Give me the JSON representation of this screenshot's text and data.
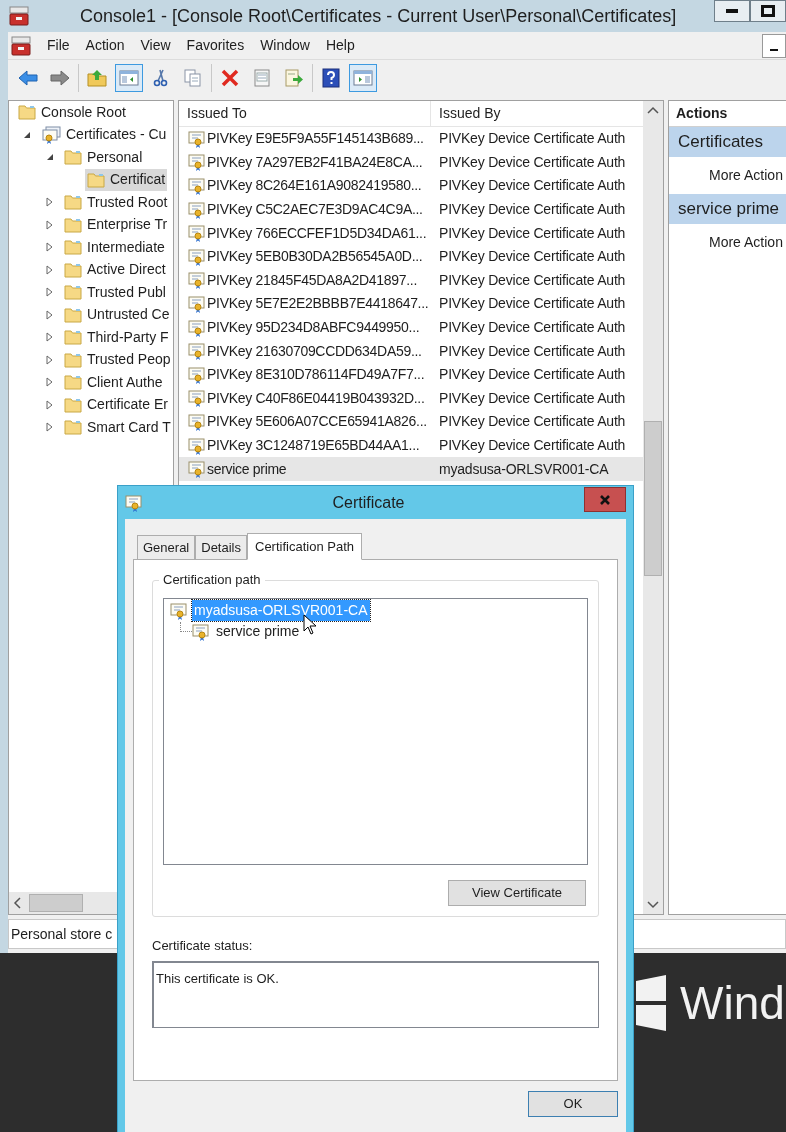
{
  "window": {
    "title": "Console1 - [Console Root\\Certificates - Current User\\Personal\\Certificates]"
  },
  "menu": [
    "File",
    "Action",
    "View",
    "Favorites",
    "Window",
    "Help"
  ],
  "toolbar_groups": [
    [
      {
        "kind": "back",
        "pressed": false
      },
      {
        "kind": "forward",
        "pressed": false
      }
    ],
    [
      {
        "kind": "up",
        "pressed": false
      },
      {
        "kind": "tree",
        "pressed": true
      },
      {
        "kind": "cut",
        "pressed": false
      },
      {
        "kind": "copy",
        "pressed": false
      }
    ],
    [
      {
        "kind": "delete",
        "pressed": false
      },
      {
        "kind": "properties",
        "pressed": false
      },
      {
        "kind": "export",
        "pressed": false
      }
    ],
    [
      {
        "kind": "help",
        "pressed": false
      },
      {
        "kind": "actionpane",
        "pressed": true
      }
    ]
  ],
  "tree": [
    {
      "label": "Console Root",
      "kind": "folder",
      "selected": false,
      "children": [
        {
          "label": "Certificates - Cu",
          "kind": "store",
          "expanded": true,
          "selected": false,
          "children": [
            {
              "label": "Personal",
              "kind": "folder",
              "expanded": true,
              "selected": false,
              "children": [
                {
                  "label": "Certificat",
                  "kind": "folder",
                  "selected": true
                }
              ]
            },
            {
              "label": "Trusted Root",
              "kind": "folder",
              "expanded": false,
              "selected": false
            },
            {
              "label": "Enterprise Tr",
              "kind": "folder",
              "expanded": false,
              "selected": false
            },
            {
              "label": "Intermediate",
              "kind": "folder",
              "expanded": false,
              "selected": false
            },
            {
              "label": "Active Direct",
              "kind": "folder",
              "expanded": false,
              "selected": false
            },
            {
              "label": "Trusted Publ",
              "kind": "folder",
              "expanded": false,
              "selected": false
            },
            {
              "label": "Untrusted Ce",
              "kind": "folder",
              "expanded": false,
              "selected": false
            },
            {
              "label": "Third-Party F",
              "kind": "folder",
              "expanded": false,
              "selected": false
            },
            {
              "label": "Trusted Peop",
              "kind": "folder",
              "expanded": false,
              "selected": false
            },
            {
              "label": "Client Authe",
              "kind": "folder",
              "expanded": false,
              "selected": false
            },
            {
              "label": "Certificate Er",
              "kind": "folder",
              "expanded": false,
              "selected": false
            },
            {
              "label": "Smart Card T",
              "kind": "folder",
              "expanded": false,
              "selected": false
            }
          ]
        }
      ]
    }
  ],
  "list": {
    "columns": [
      "Issued To",
      "Issued By"
    ],
    "rows": [
      {
        "issued_to": "PIVKey E9E5F9A55F145143B689...",
        "issued_by": "PIVKey Device Certificate Auth",
        "selected": false
      },
      {
        "issued_to": "PIVKey 7A297EB2F41BA24E8CA...",
        "issued_by": "PIVKey Device Certificate Auth",
        "selected": false
      },
      {
        "issued_to": "PIVKey 8C264E161A9082419580...",
        "issued_by": "PIVKey Device Certificate Auth",
        "selected": false
      },
      {
        "issued_to": "PIVKey C5C2AEC7E3D9AC4C9A...",
        "issued_by": "PIVKey Device Certificate Auth",
        "selected": false
      },
      {
        "issued_to": "PIVKey 766ECCFEF1D5D34DA61...",
        "issued_by": "PIVKey Device Certificate Auth",
        "selected": false
      },
      {
        "issued_to": "PIVKey 5EB0B30DA2B56545A0D...",
        "issued_by": "PIVKey Device Certificate Auth",
        "selected": false
      },
      {
        "issued_to": "PIVKey 21845F45DA8A2D41897...",
        "issued_by": "PIVKey Device Certificate Auth",
        "selected": false
      },
      {
        "issued_to": "PIVKey 5E7E2E2BBBB7E4418647...",
        "issued_by": "PIVKey Device Certificate Auth",
        "selected": false
      },
      {
        "issued_to": "PIVKey 95D234D8ABFC9449950...",
        "issued_by": "PIVKey Device Certificate Auth",
        "selected": false
      },
      {
        "issued_to": "PIVKey 21630709CCDD634DA59...",
        "issued_by": "PIVKey Device Certificate Auth",
        "selected": false
      },
      {
        "issued_to": "PIVKey 8E310D786114FD49A7F7...",
        "issued_by": "PIVKey Device Certificate Auth",
        "selected": false
      },
      {
        "issued_to": "PIVKey C40F86E04419B043932D...",
        "issued_by": "PIVKey Device Certificate Auth",
        "selected": false
      },
      {
        "issued_to": "PIVKey 5E606A07CCE65941A826...",
        "issued_by": "PIVKey Device Certificate Auth",
        "selected": false
      },
      {
        "issued_to": "PIVKey 3C1248719E65BD44AA1...",
        "issued_by": "PIVKey Device Certificate Auth",
        "selected": false
      },
      {
        "issued_to": "service prime",
        "issued_by": "myadsusa-ORLSVR001-CA",
        "selected": true
      }
    ]
  },
  "actions": {
    "title": "Actions",
    "sections": [
      {
        "title": "Certificates",
        "items": [
          "More Action"
        ]
      },
      {
        "title": "service prime",
        "items": [
          "More Action"
        ]
      }
    ]
  },
  "status_bar": "Personal store c",
  "desktop": {
    "brand_text": "Wind"
  },
  "dialog": {
    "title": "Certificate",
    "tabs": [
      {
        "label": "General",
        "selected": false
      },
      {
        "label": "Details",
        "selected": false
      },
      {
        "label": "Certification Path",
        "selected": true
      }
    ],
    "group_label": "Certification path",
    "path": [
      {
        "label": "myadsusa-ORLSVR001-CA",
        "selected": true,
        "children": [
          {
            "label": "service prime",
            "selected": false
          }
        ]
      }
    ],
    "view_button": "View Certificate",
    "status_label": "Certificate status:",
    "status_text": "This certificate is OK.",
    "ok_button": "OK"
  }
}
